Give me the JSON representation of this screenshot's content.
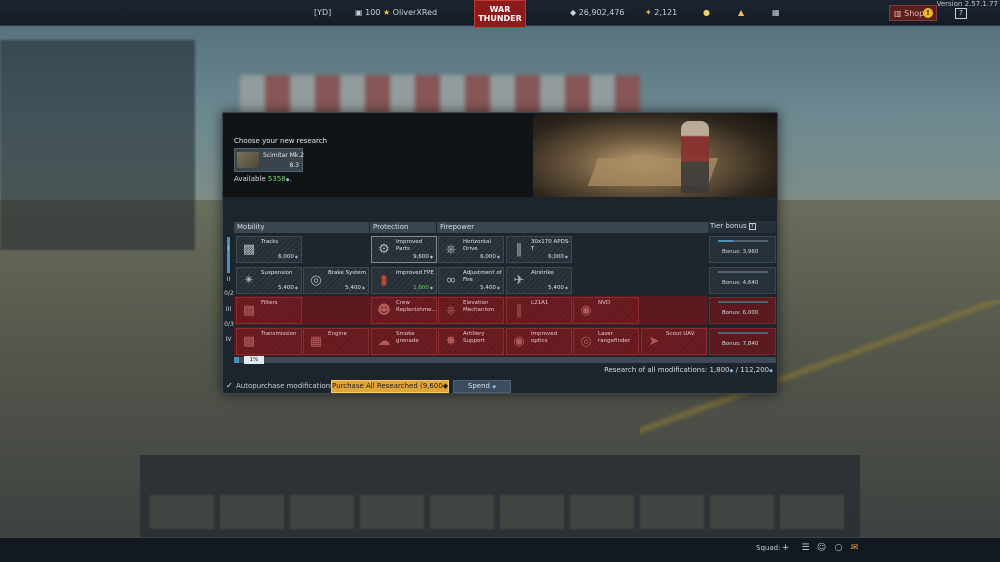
{
  "topbar": {
    "clan_tag": "[YD]",
    "level": "100",
    "username": "OliverXRed",
    "logo_line1": "WAR",
    "logo_line2": "THUNDER",
    "silver_lions": "26,902,476",
    "golden_eagles": "2,121",
    "shop_label": "Shop",
    "shop_alert": "!",
    "help_label": "?",
    "version": "Version 2.57.1.77"
  },
  "dialog": {
    "choose_label": "Choose your new research",
    "vehicle_name": "Scimitar Mk.2",
    "vehicle_br": "8.3",
    "available_label": "Available",
    "available_value": "5358"
  },
  "columns": {
    "mobility": "Mobility",
    "protection": "Protection",
    "firepower": "Firepower",
    "tier_bonus": "Tier bonus",
    "tier_bonus_help": "?"
  },
  "tiers": [
    {
      "label": "I"
    },
    {
      "label": "II",
      "count": "0/2"
    },
    {
      "label": "III",
      "count": "0/3"
    },
    {
      "label": "IV"
    }
  ],
  "modules": {
    "tracks": {
      "name": "Tracks",
      "cost": "6,000"
    },
    "improved_parts": {
      "name": "Improved Parts",
      "cost": "9,600"
    },
    "horizontal_drive": {
      "name": "Horizontal Drive",
      "cost": "6,000"
    },
    "apds": {
      "name": "30x170 APDS-T",
      "cost": "6,000"
    },
    "suspension": {
      "name": "Suspension",
      "cost": "5,400"
    },
    "brake_system": {
      "name": "Brake System",
      "cost": "5,400"
    },
    "improved_fpe": {
      "name": "Improved FPE",
      "cost": "1,600"
    },
    "adjustment_of_fire": {
      "name": "Adjustment of Fire",
      "cost": "5,400"
    },
    "airstrike": {
      "name": "Airstrike",
      "cost": "5,400"
    },
    "filters": {
      "name": "Filters"
    },
    "crew_replenishment": {
      "name": "Crew Replenishme..."
    },
    "elevation_mechanism": {
      "name": "Elevation Mechanism"
    },
    "l21a1": {
      "name": "L21A1"
    },
    "nvd": {
      "name": "NVD"
    },
    "transmission": {
      "name": "Transmission"
    },
    "engine": {
      "name": "Engine"
    },
    "smoke_grenade": {
      "name": "Smoke grenade"
    },
    "artillery_support": {
      "name": "Artillery Support"
    },
    "improved_optics": {
      "name": "Improved optics"
    },
    "laser_rangefinder": {
      "name": "Laser rangefinder"
    },
    "scout_uav": {
      "name": "Scout UAV"
    }
  },
  "tier_bonus": [
    {
      "text": "Bonus: 3,960"
    },
    {
      "text": "Bonus: 4,640"
    },
    {
      "text": "Bonus: 6,000"
    },
    {
      "text": "Bonus: 7,840"
    }
  ],
  "progress": {
    "percent_value": 1,
    "percent_label": "1%"
  },
  "research_all": {
    "label": "Research of all modifications:",
    "current": "1,800",
    "total": "112,200"
  },
  "footer": {
    "autopurchase_label": "Autopurchase modifications",
    "purchase_all_label": "Purchase All Researched (9,600",
    "spend_label": "Spend"
  },
  "bottombar": {
    "squad_label": "Squad:"
  },
  "icons": {
    "logo": "war-thunder-logo",
    "silver": "silver-lions-icon",
    "gold": "golden-eagle-icon",
    "lightbulb": "lightbulb-icon",
    "cart": "shopping-cart-icon"
  },
  "colors": {
    "accent_blue": "#4a90b8",
    "locked_red": "#5a1a1e",
    "purchase_gold": "#e3a43a",
    "available_green": "#76d06b"
  }
}
